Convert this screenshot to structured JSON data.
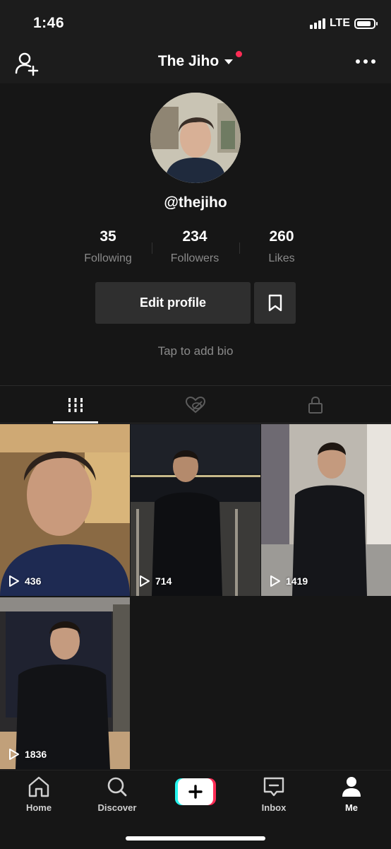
{
  "status": {
    "time": "1:46",
    "network": "LTE",
    "battery_level": 0.85
  },
  "nav": {
    "title": "The Jiho"
  },
  "profile": {
    "username": "@thejiho",
    "stats": [
      {
        "value": "35",
        "label": "Following"
      },
      {
        "value": "234",
        "label": "Followers"
      },
      {
        "value": "260",
        "label": "Likes"
      }
    ],
    "edit_label": "Edit profile",
    "bio_placeholder": "Tap to add bio"
  },
  "tabs": [
    {
      "icon": "grid-icon",
      "active": true
    },
    {
      "icon": "liked-hidden-icon",
      "active": false
    },
    {
      "icon": "lock-icon",
      "active": false
    }
  ],
  "videos": [
    {
      "views": "436"
    },
    {
      "views": "714"
    },
    {
      "views": "1419"
    },
    {
      "views": "1836"
    }
  ],
  "tabbar": {
    "items": [
      {
        "label": "Home",
        "icon": "home-icon"
      },
      {
        "label": "Discover",
        "icon": "search-icon"
      },
      {
        "label": "",
        "icon": "plus-icon"
      },
      {
        "label": "Inbox",
        "icon": "inbox-icon"
      },
      {
        "label": "Me",
        "icon": "person-icon"
      }
    ]
  },
  "colors": {
    "background": "#161616",
    "accent": "#fe2c55",
    "cyan": "#25f4ee"
  }
}
